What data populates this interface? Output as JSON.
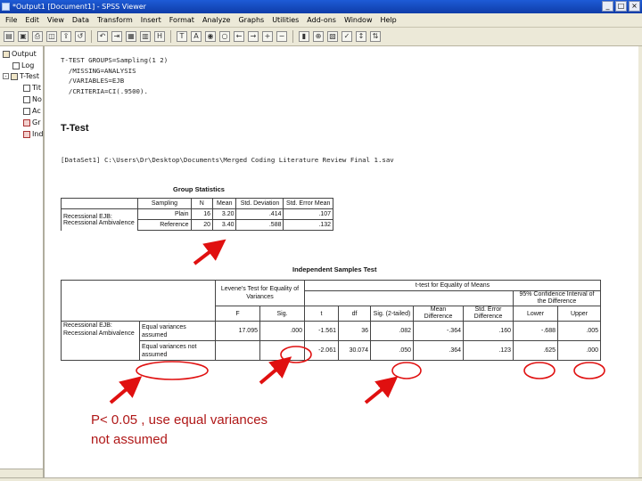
{
  "window": {
    "title": "*Output1 [Document1] - SPSS Viewer",
    "buttons": [
      "_",
      "□",
      "×"
    ]
  },
  "menu": [
    "File",
    "Edit",
    "View",
    "Data",
    "Transform",
    "Insert",
    "Format",
    "Analyze",
    "Graphs",
    "Utilities",
    "Add-ons",
    "Window",
    "Help"
  ],
  "toolbar": {
    "icons": [
      "open-icon",
      "save-icon",
      "print-icon",
      "print-preview-icon",
      "export-icon",
      "dialog-recall-icon",
      "undo-icon",
      "goto-case-icon",
      "goto-data-icon",
      "variables-icon",
      "insert-heading-icon",
      "insert-title-icon",
      "insert-text-icon",
      "show-icon",
      "hide-icon",
      "promote-icon",
      "demote-icon",
      "expand-icon",
      "collapse-icon",
      "designate-window-icon",
      "zoom-icon",
      "insert-output-icon",
      "select-cases-icon",
      "scroll-icon",
      "sort-icon"
    ]
  },
  "nav_tree": {
    "items": [
      {
        "label": "Output",
        "icon": "folder"
      },
      {
        "label": "Log",
        "icon": "doc"
      },
      {
        "label": "T-Test",
        "icon": "folder"
      },
      {
        "label": "Tit",
        "icon": "doc"
      },
      {
        "label": "No",
        "icon": "doc"
      },
      {
        "label": "Ac",
        "icon": "doc"
      },
      {
        "label": "Gr",
        "icon": "red"
      },
      {
        "label": "Ind",
        "icon": "red"
      }
    ]
  },
  "syntax": {
    "lines": [
      "T-TEST GROUPS=Sampling(1 2)",
      "  /MISSING=ANALYSIS",
      "  /VARIABLES=EJB",
      "  /CRITERIA=CI(.9500)."
    ]
  },
  "section_title": "T-Test",
  "dataset_line": "[DataSet1] C:\\Users\\Dr\\Desktop\\Documents\\Merged Coding Literature Review Final 1.sav",
  "group_statistics": {
    "caption": "Group Statistics",
    "headers": [
      "Sampling",
      "N",
      "Mean",
      "Std. Deviation",
      "Std. Error Mean"
    ],
    "row_label": [
      "Recessional EJB:",
      "Recessional Ambivalence"
    ],
    "rows": [
      [
        "Plain",
        "16",
        "3.20",
        ".414",
        ".107"
      ],
      [
        "Reference",
        "20",
        "3.40",
        ".588",
        ".132"
      ]
    ]
  },
  "independent_test": {
    "caption": "Independent Samples Test",
    "group_headers": [
      "Levene's Test for Equality of Variances",
      "t-test for Equality of Means"
    ],
    "ci_header": "95% Confidence Interval of the Difference",
    "headers": [
      "F",
      "Sig.",
      "t",
      "df",
      "Sig. (2-tailed)",
      "Mean Difference",
      "Std. Error Difference",
      "Lower",
      "Upper"
    ],
    "row_label": [
      "Recessional EJB:",
      "Recessional Ambivalence"
    ],
    "rows": [
      {
        "label": [
          "Equal variances",
          "assumed"
        ],
        "values": [
          "17.095",
          ".000",
          "-1.561",
          "36",
          ".082",
          "-.364",
          ".160",
          "-.688",
          ".005"
        ]
      },
      {
        "label": [
          "Equal variances not",
          "assumed"
        ],
        "values": [
          "",
          "",
          "-2.061",
          "30.074",
          ".050",
          ".364",
          ".123",
          ".625",
          ".000"
        ]
      }
    ]
  },
  "annotation": {
    "note": "P< 0.05 , use equal variances\nnot assumed",
    "color": "#b01818"
  }
}
